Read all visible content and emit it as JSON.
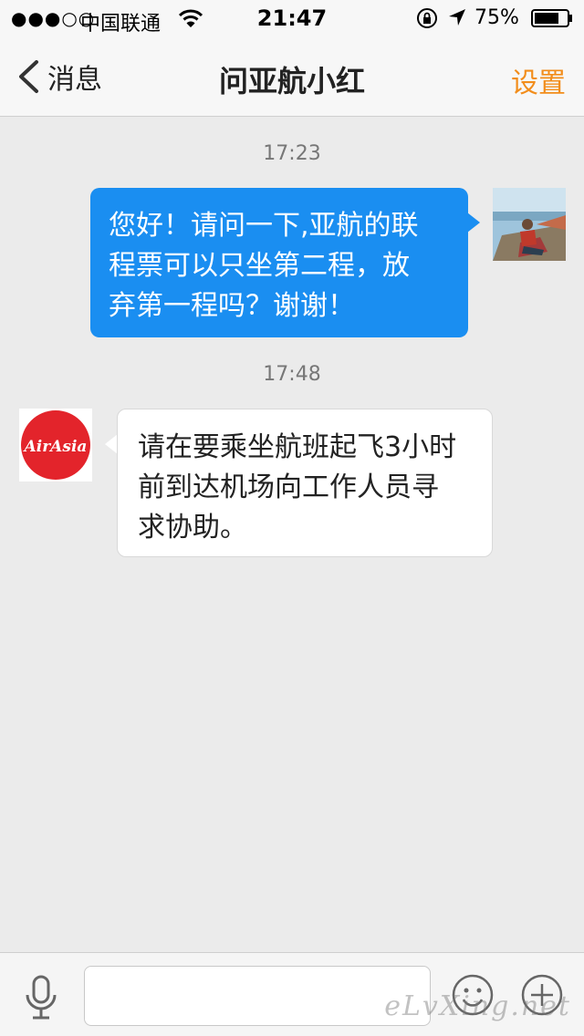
{
  "status_bar": {
    "signal": "●●●○○",
    "carrier": "中国联通",
    "time": "21:47",
    "battery_percent": "75%",
    "battery_level": 0.75
  },
  "nav": {
    "back_label": "消息",
    "title": "问亚航小红",
    "right_label": "设置",
    "accent_color": "#f28d1b"
  },
  "messages": [
    {
      "timestamp": "17:23",
      "direction": "outgoing",
      "text_lines": [
        "您好！请问一下,亚航的联",
        "程票可以只坐第二程，放",
        "弃第一程吗？谢谢！"
      ]
    },
    {
      "timestamp": "17:48",
      "direction": "incoming",
      "sender_logo": "AirAsia",
      "text_lines": [
        "请在要乘坐航班起飞3小时",
        "前到达机场向工作人员寻",
        "求协助。"
      ]
    }
  ],
  "input": {
    "value": "",
    "placeholder": ""
  },
  "icons": [
    "microphone-icon",
    "emoji-icon",
    "plus-icon"
  ],
  "watermark": "eLvXing.net",
  "colors": {
    "outgoing_bubble": "#1a8ef1",
    "incoming_bubble": "#ffffff",
    "airasia_red": "#e3242b"
  }
}
